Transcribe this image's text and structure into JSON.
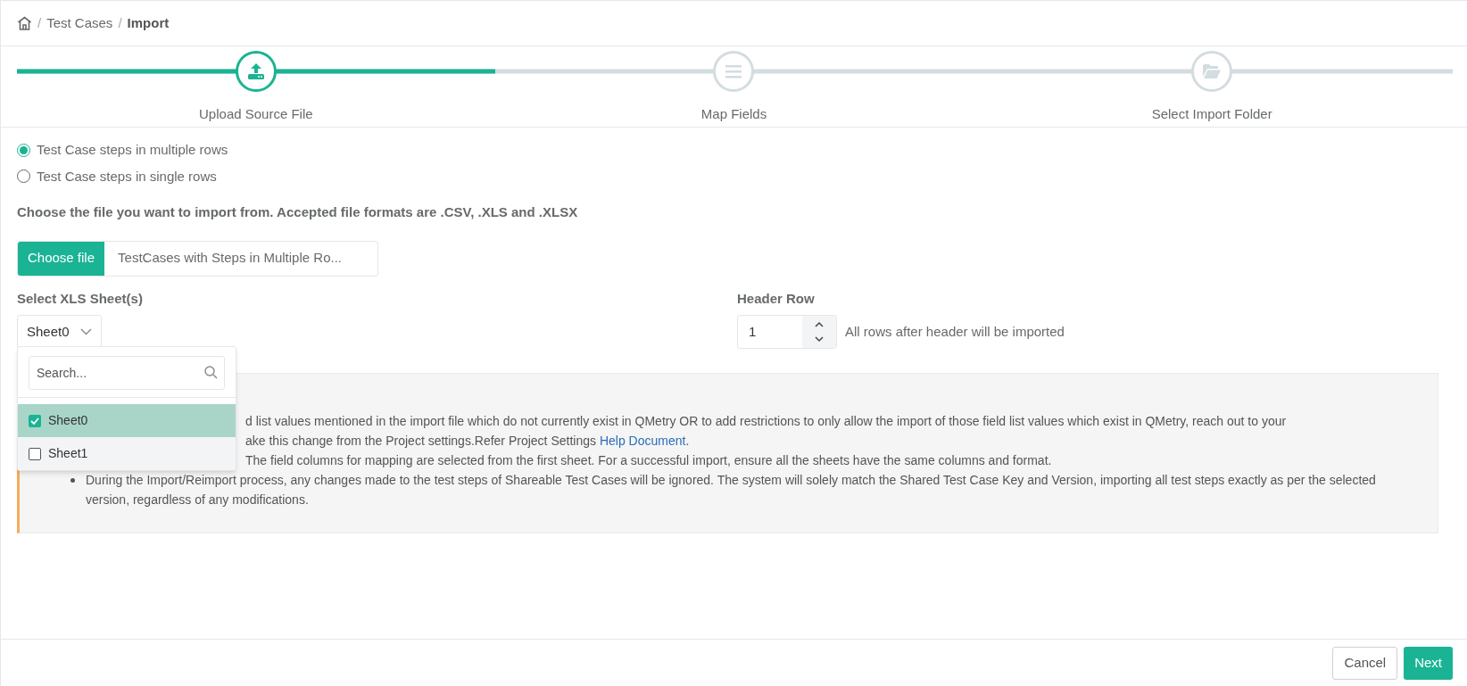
{
  "breadcrumb": [
    {
      "separator": "/",
      "label": "Test Cases",
      "current": false
    },
    {
      "separator": "/",
      "label": "Import",
      "current": true
    }
  ],
  "steps": [
    {
      "label": "Upload Source File",
      "selected": true
    },
    {
      "label": "Map Fields",
      "selected": false
    },
    {
      "label": "Select Import Folder",
      "selected": false
    }
  ],
  "progress": {
    "level": 0.333
  },
  "layout_options": [
    {
      "label": "Test Case steps in multiple rows",
      "selected": true
    },
    {
      "label": "Test Case steps in single rows",
      "selected": false
    }
  ],
  "file_prompt": "Choose the file you want to import from. Accepted file formats are .CSV, .XLS and .XLSX",
  "file_picker": {
    "button": "Choose file",
    "value": "TestCases with Steps in Multiple Ro..."
  },
  "sheet_select": {
    "label": "Select XLS Sheet(s)",
    "value": "Sheet0",
    "search_placeholder": "Search...",
    "options": [
      {
        "label": "Sheet0",
        "checked": true
      },
      {
        "label": "Sheet1",
        "checked": false
      }
    ]
  },
  "header_row": {
    "label": "Header Row",
    "value": "1",
    "hint": "All rows after header will be imported"
  },
  "notes": [
    {
      "lines": [
        "d list values mentioned in the import file which do not currently exist in QMetry OR to add restrictions to only allow the import of those field list values which exist in QMetry, reach out to your",
        "ake this change from the Project settings.Refer Project Settings "
      ],
      "link": "Help Document",
      "tail": ".",
      "kind": "partial"
    },
    {
      "lines": [
        "The field columns for mapping are selected from the first sheet. For a successful import, ensure all the sheets have the same columns and format."
      ],
      "kind": "partial"
    },
    {
      "lines": [
        "During the Import/Reimport process, any changes made to the test steps of Shareable Test Cases will be ignored. The system will solely match the Shared Test Case Key and Version, importing all test steps exactly as per the selected version, regardless of any modifications."
      ],
      "kind": "bullet"
    }
  ],
  "buttons": [
    {
      "label": "Cancel",
      "kind": "secondary"
    },
    {
      "label": "Next",
      "kind": "primary"
    }
  ]
}
